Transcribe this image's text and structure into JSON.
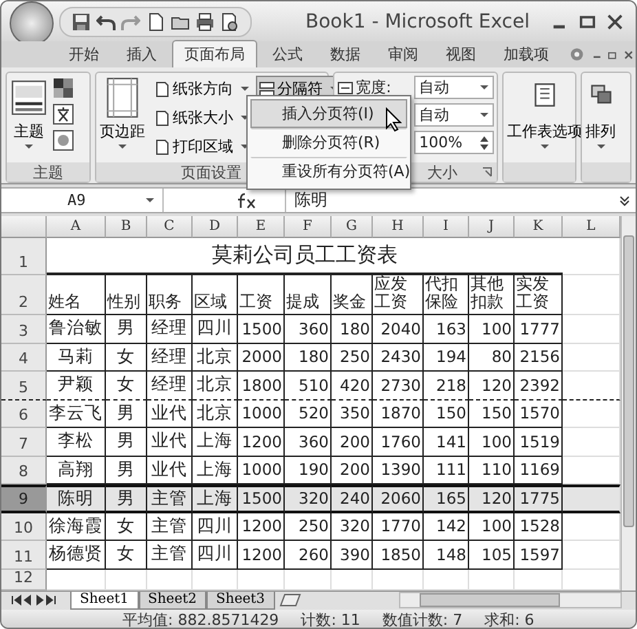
{
  "window": {
    "title": "Book1 - Microsoft Excel"
  },
  "ribbon_tabs": [
    {
      "label": "开始",
      "selected": false
    },
    {
      "label": "插入",
      "selected": false
    },
    {
      "label": "页面布局",
      "selected": true
    },
    {
      "label": "公式",
      "selected": false
    },
    {
      "label": "数据",
      "selected": false
    },
    {
      "label": "审阅",
      "selected": false
    },
    {
      "label": "视图",
      "selected": false
    },
    {
      "label": "加载项",
      "selected": false
    }
  ],
  "theme_group": {
    "button": "主题",
    "label": "主题"
  },
  "page_setup_group": {
    "button": "页边距",
    "items": [
      "纸张方向",
      "纸张大小",
      "打印区域"
    ],
    "breaks": {
      "label": "分隔符",
      "pressed": true
    },
    "label": "页面设置"
  },
  "scale_group": {
    "width_label": "宽度:",
    "width_value": "自动",
    "height_value": "自动",
    "scale_value": "100%",
    "label": "大小"
  },
  "sheet_options_button": "工作表选项",
  "arrange_button": "排列",
  "breaks_menu": {
    "items": [
      {
        "label": "插入分页符(I)",
        "highlighted": true
      },
      {
        "label": "删除分页符(R)",
        "highlighted": false
      },
      {
        "label": "重设所有分页符(A)",
        "highlighted": false
      }
    ]
  },
  "formula_bar": {
    "name_box": "A9",
    "value": "陈明"
  },
  "columns": [
    "A",
    "B",
    "C",
    "D",
    "E",
    "F",
    "G",
    "H",
    "I",
    "J",
    "K",
    "L"
  ],
  "title_row": {
    "header": "1",
    "title": "莫莉公司员工工资表"
  },
  "header_row": {
    "header": "2",
    "cells": [
      "姓名",
      "性别",
      "职务",
      "区域",
      "工资",
      "提成",
      "奖金",
      "应发工资",
      "代扣保险",
      "其他扣款",
      "实发工资"
    ]
  },
  "rows": [
    {
      "header": "3",
      "cells": [
        "鲁治敏",
        "男",
        "经理",
        "四川",
        "1500",
        "360",
        "180",
        "2040",
        "163",
        "100",
        "1777"
      ],
      "selected": false,
      "page_break_after": false
    },
    {
      "header": "4",
      "cells": [
        "马莉",
        "女",
        "经理",
        "北京",
        "2000",
        "180",
        "250",
        "2430",
        "194",
        "80",
        "2156"
      ],
      "selected": false,
      "page_break_after": false
    },
    {
      "header": "5",
      "cells": [
        "尹颖",
        "女",
        "经理",
        "北京",
        "1800",
        "510",
        "420",
        "2730",
        "218",
        "120",
        "2392"
      ],
      "selected": false,
      "page_break_after": true
    },
    {
      "header": "6",
      "cells": [
        "李云飞",
        "男",
        "业代",
        "北京",
        "1000",
        "520",
        "350",
        "1870",
        "150",
        "150",
        "1570"
      ],
      "selected": false,
      "page_break_after": false
    },
    {
      "header": "7",
      "cells": [
        "李松",
        "男",
        "业代",
        "上海",
        "1200",
        "360",
        "200",
        "1760",
        "141",
        "100",
        "1519"
      ],
      "selected": false,
      "page_break_after": false
    },
    {
      "header": "8",
      "cells": [
        "高翔",
        "男",
        "业代",
        "上海",
        "1000",
        "190",
        "200",
        "1390",
        "111",
        "110",
        "1169"
      ],
      "selected": false,
      "page_break_after": false
    },
    {
      "header": "9",
      "cells": [
        "陈明",
        "男",
        "主管",
        "上海",
        "1500",
        "320",
        "240",
        "2060",
        "165",
        "120",
        "1775"
      ],
      "selected": true,
      "page_break_after": false
    },
    {
      "header": "10",
      "cells": [
        "徐海霞",
        "女",
        "主管",
        "四川",
        "1200",
        "250",
        "320",
        "1770",
        "142",
        "100",
        "1528"
      ],
      "selected": false,
      "page_break_after": false
    },
    {
      "header": "11",
      "cells": [
        "杨德贤",
        "女",
        "主管",
        "四川",
        "1200",
        "260",
        "390",
        "1850",
        "148",
        "105",
        "1597"
      ],
      "selected": false,
      "page_break_after": false
    }
  ],
  "empty_row": {
    "header": "12"
  },
  "sheet_tabs": [
    {
      "label": "Sheet1",
      "selected": true
    },
    {
      "label": "Sheet2",
      "selected": false
    },
    {
      "label": "Sheet3",
      "selected": false
    }
  ],
  "status_bar": [
    "平均值: 882.8571429",
    "计数: 11",
    "数值计数: 7",
    "求和: 6"
  ]
}
